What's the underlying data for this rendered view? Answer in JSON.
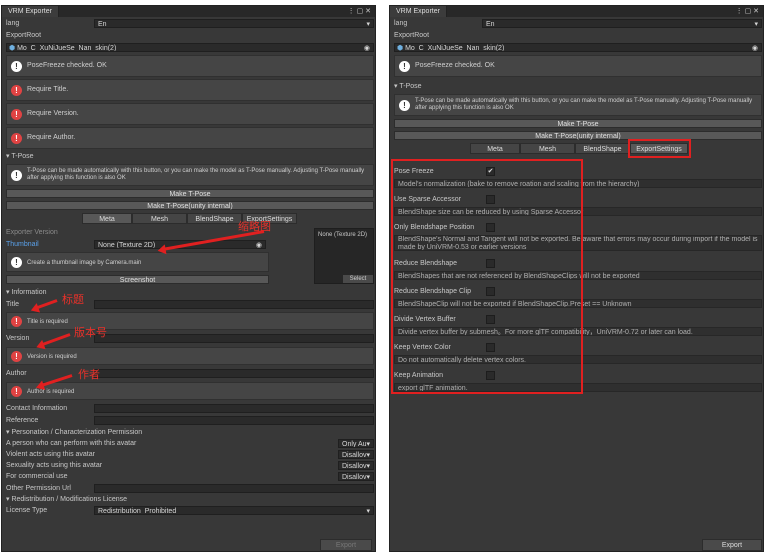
{
  "left": {
    "window_title": "VRM Exporter",
    "lang_label": "lang",
    "lang_value": "En",
    "export_root_label": "ExportRoot",
    "export_root_value": "Mo_C_XuNiJueSe_Nan_skin(2)",
    "msg_posefreeze": "PoseFreeze checked. OK",
    "msg_title": "Require Title.",
    "msg_version": "Require Version.",
    "msg_author": "Require Author.",
    "tpose_header": "T-Pose",
    "tpose_help": "T-Pose can be made automatically with this button, or you can make the model as T-Pose manually. Adjusting T-Pose manually after applying this function is also OK",
    "make_tpose": "Make T-Pose",
    "make_tpose_internal": "Make T-Pose(unity internal)",
    "tabs": [
      "Meta",
      "Mesh",
      "BlendShape",
      "ExportSettings"
    ],
    "exporter_version_label": "Exporter Version",
    "thumbnail_label": "Thumbnail",
    "thumbnail_value": "None (Texture 2D)",
    "preview_label": "None (Texture 2D)",
    "preview_select": "Select",
    "thumbnail_help": "Create a thumbnail image by Camera.main",
    "screenshot_btn": "Screenshot",
    "information_header": "Information",
    "title_label": "Title",
    "title_required": "Title is required",
    "version_label": "Version",
    "version_required": "Version is required",
    "author_label": "Author",
    "author_required": "Author is required",
    "contact_label": "Contact Information",
    "reference_label": "Reference",
    "personation_header": "Personation / Characterization Permission",
    "perm_rows": [
      {
        "label": "A person who can perform with this avatar",
        "value": "Only Au"
      },
      {
        "label": "Violent acts using this avatar",
        "value": "Disallov"
      },
      {
        "label": "Sexuality acts using this avatar",
        "value": "Disallov"
      },
      {
        "label": "For commercial use",
        "value": "Disallov"
      }
    ],
    "other_perm_label": "Other Permission Url",
    "redistribution_header": "Redistribution / Modifications License",
    "license_label": "License Type",
    "license_value": "Redistribution_Prohibited",
    "export_btn": "Export",
    "anno_title": "标题",
    "anno_version": "版本号",
    "anno_author": "作者",
    "anno_thumb": "缩略图"
  },
  "right": {
    "window_title": "VRM Exporter",
    "lang_label": "lang",
    "lang_value": "En",
    "export_root_label": "ExportRoot",
    "export_root_value": "Mo_C_XuNiJueSe_Nan_skin(2)",
    "msg_posefreeze": "PoseFreeze checked. OK",
    "tpose_header": "T-Pose",
    "tpose_help": "T-Pose can be made automatically with this button, or you can make the model as T-Pose manually. Adjusting T-Pose manually after applying this function is also OK",
    "make_tpose": "Make T-Pose",
    "make_tpose_internal": "Make T-Pose(unity internal)",
    "tabs": [
      "Meta",
      "Mesh",
      "BlendShape",
      "ExportSettings"
    ],
    "settings": [
      {
        "label": "Pose Freeze",
        "checked": "✔",
        "desc": "Model's normalization (bake to remove roation and scaling from the hierarchy)"
      },
      {
        "label": "Use Sparse Accessor",
        "checked": "",
        "desc": "BlendShape size can be reduced by using Sparse Accessor"
      },
      {
        "label": "Only Blendshape Position",
        "checked": "",
        "desc": "BlendShape's Normal and Tangent will not be exported. Be aware that errors may occur during import if the model is made by UniVRM-0.53 or earlier versions"
      },
      {
        "label": "Reduce Blendshape",
        "checked": "",
        "desc": "BlendShapes that are not referenced by BlendShapeClips will not be exported"
      },
      {
        "label": "Reduce Blendshape Clip",
        "checked": "",
        "desc": "BlendShapeClip will not be exported if BlendShapeClip.Preset == Unknown"
      },
      {
        "label": "Divide Vertex Buffer",
        "checked": "",
        "desc": "Divide vertex buffer by submesh。For more glTF compatibility，UniVRM-0.72 or later can load."
      },
      {
        "label": "Keep Vertex Color",
        "checked": "",
        "desc": "Do not automatically delete vertex colors."
      },
      {
        "label": "Keep Animation",
        "checked": "",
        "desc": "export glTF animation."
      }
    ],
    "export_btn": "Export"
  },
  "colors": {
    "accent_red": "#e02020",
    "panel_bg": "#383838",
    "error_icon": "#e04343",
    "link_blue": "#5aa0e8"
  }
}
